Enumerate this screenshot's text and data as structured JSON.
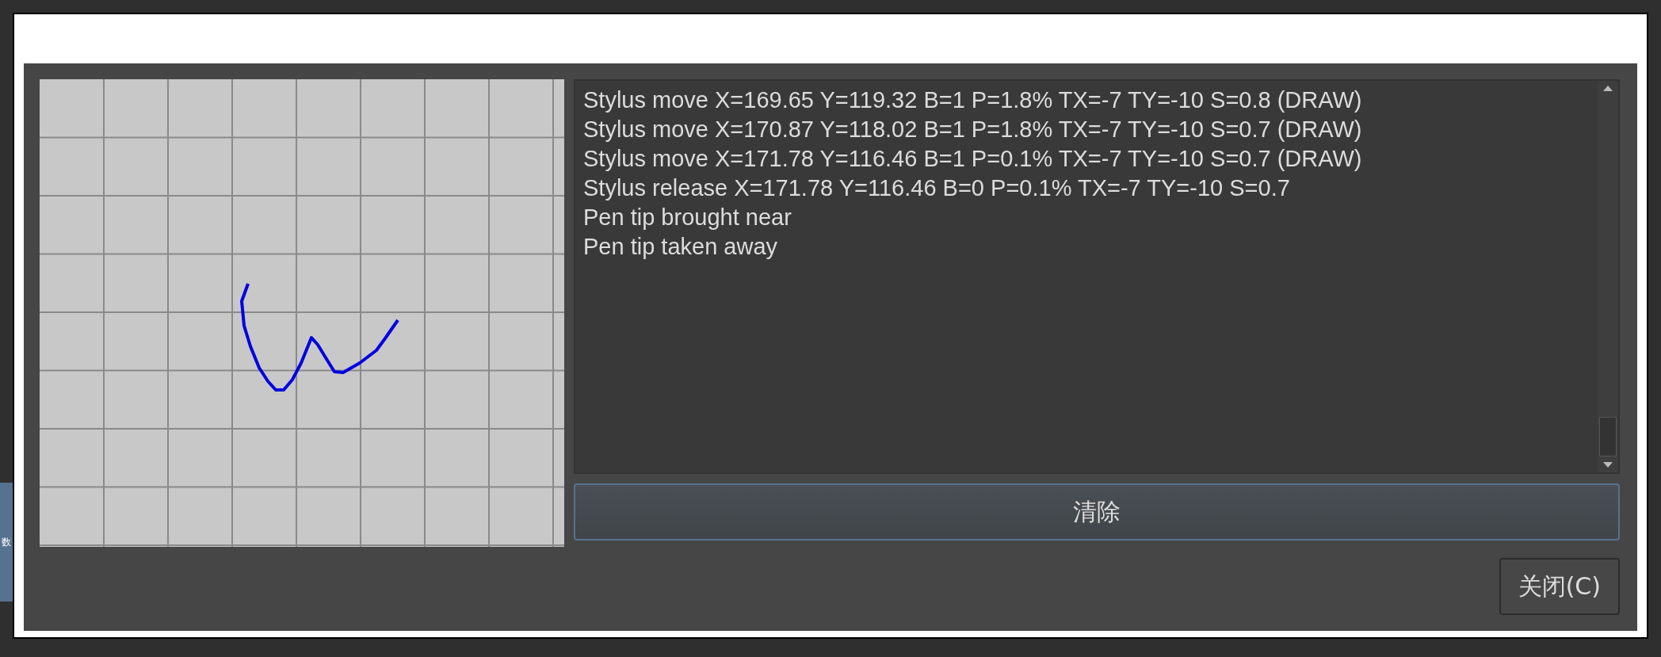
{
  "side_tab": {
    "label": "数"
  },
  "log": {
    "entries": [
      "Stylus move X=169.65 Y=119.32 B=1 P=1.8% TX=-7 TY=-10 S=0.8 (DRAW)",
      "Stylus move X=170.87 Y=118.02 B=1 P=1.8% TX=-7 TY=-10 S=0.7 (DRAW)",
      "Stylus move X=171.78 Y=116.46 B=1 P=0.1% TX=-7 TY=-10 S=0.7 (DRAW)",
      "Stylus release X=171.78 Y=116.46 B=0 P=0.1% TX=-7 TY=-10 S=0.7",
      "Pen tip brought near",
      "Pen tip taken away"
    ]
  },
  "buttons": [
    {
      "label": "清除",
      "kind": "wide"
    },
    {
      "label": "关闭(C)",
      "kind": "dialog"
    }
  ]
}
